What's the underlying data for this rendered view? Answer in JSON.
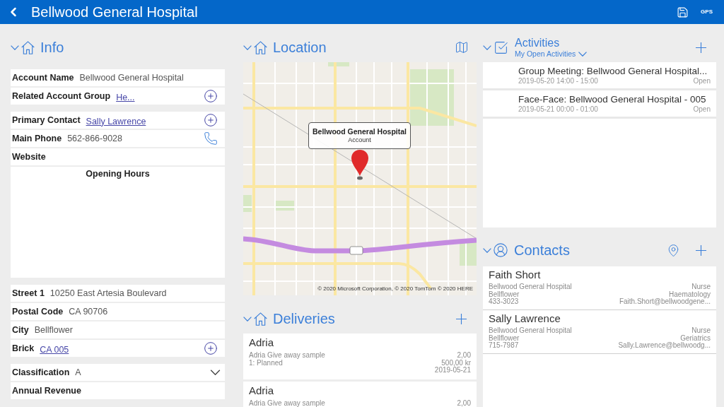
{
  "header": {
    "title": "Bellwood General Hospital",
    "action": "GPS"
  },
  "info": {
    "title": "Info",
    "expanded": true,
    "groups": [
      [
        {
          "kind": "text",
          "label": "Account Name",
          "value": "Bellwood General Hospital"
        },
        {
          "kind": "lookup",
          "label": "Related Account Group",
          "value": "He..."
        }
      ],
      [
        {
          "kind": "lookup",
          "label": "Primary Contact",
          "value": "Sally Lawrence"
        },
        {
          "kind": "phone",
          "label": "Main Phone",
          "value": "562-866-9028"
        },
        {
          "kind": "text",
          "label": "Website"
        },
        {
          "kind": "block",
          "label": "Opening Hours"
        }
      ],
      [
        {
          "kind": "text",
          "label": "Street 1",
          "value": "10250 East Artesia Boulevard"
        },
        {
          "kind": "text",
          "label": "Postal Code",
          "value": "CA 90706"
        },
        {
          "kind": "text",
          "label": "City",
          "value": "Bellflower"
        },
        {
          "kind": "lookup",
          "label": "Brick",
          "value": "CA 005"
        }
      ],
      [
        {
          "kind": "choice",
          "label": "Classification",
          "value": "A"
        },
        {
          "kind": "text",
          "label": "Annual Revenue"
        }
      ]
    ]
  },
  "location": {
    "title": "Location",
    "expanded": true,
    "map": {
      "callout": {
        "title": "Bellwood General Hospital",
        "subtitle": "Account"
      },
      "attribution": "© 2020 Microsoft Corporation, © 2020 TomTom © 2020 HERE"
    }
  },
  "deliveries": {
    "title": "Deliveries",
    "expanded": true,
    "items": [
      {
        "name": "Adria",
        "product": "Adria Give away sample",
        "status": "1: Planned",
        "quantity": "2,00",
        "amount": "500,00 kr",
        "date": "2019-05-21"
      },
      {
        "name": "Adria",
        "product": "Adria Give away sample",
        "quantity": "2,00"
      }
    ]
  },
  "activities": {
    "title": "Activities",
    "expanded": true,
    "view": "My Open Activities",
    "items": [
      {
        "title": "Group Meeting: Bellwood General Hospital...",
        "time": "2019-05-20 14:00 - 15:00",
        "status": "Open"
      },
      {
        "title": "Face-Face: Bellwood General Hospital - 005",
        "time": "2019-05-21 00:00 - 01:00",
        "status": "Open"
      }
    ]
  },
  "contacts": {
    "title": "Contacts",
    "expanded": true,
    "items": [
      {
        "name": "Faith Short",
        "company": "Bellwood General Hospital",
        "city": "Bellflower",
        "phone": "433-3023",
        "position": "Nurse",
        "department": "Haematology",
        "email": "Faith.Short@bellwoodgene..."
      },
      {
        "name": "Sally Lawrence",
        "company": "Bellwood General Hospital",
        "city": "Bellflower",
        "phone": "715-7987",
        "position": "Nurse",
        "department": "Geriatrics",
        "email": "Sally.Lawrence@bellwoodg..."
      }
    ]
  }
}
